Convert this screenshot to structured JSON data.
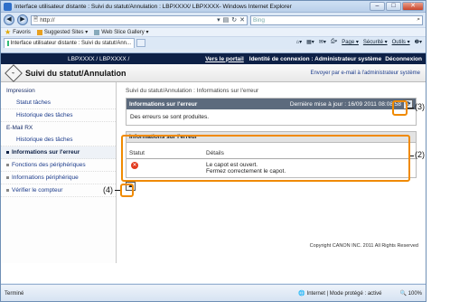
{
  "browser": {
    "title": "Interface utilisateur distante : Suivi du statut/Annulation : LBPXXXX/ LBPXXXX- Windows Internet Explorer",
    "url": "http://",
    "search_placeholder": "Bing",
    "favorites": {
      "label": "Favoris",
      "suggested": "Suggested Sites ▾",
      "gallery": "Web Slice Gallery ▾"
    },
    "tab_title": "Interface utilisateur distante : Suivi du statut/Ann...",
    "cmd": {
      "page": "Page ▾",
      "security": "Sécurité ▾",
      "tools": "Outils ▾",
      "help": "❷▾"
    },
    "status": {
      "done": "Terminé",
      "zone": "Internet | Mode protégé : activé",
      "zoom": "100%"
    }
  },
  "header": {
    "device": "LBPXXXX / LBPXXXX /",
    "portal": "Vers le portail",
    "login": "Identité de connexion : Administrateur système",
    "logout": "Déconnexion"
  },
  "page": {
    "title": "Suivi du statut/Annulation",
    "email_link": "Envoyer par e-mail à l'administrateur système"
  },
  "sidebar": {
    "group_print": "Impression",
    "items_print": [
      "Statut tâches",
      "Historique des tâches"
    ],
    "group_email": "E-Mail RX",
    "items_email": [
      "Historique des tâches"
    ],
    "items_main": [
      "Informations sur l'erreur",
      "Fonctions des périphériques",
      "Informations périphérique",
      "Vérifier le compteur"
    ]
  },
  "main": {
    "breadcrumb": "Suivi du statut/Annulation : Informations sur l'erreur",
    "panel_title": "Informations sur l'erreur",
    "last_update": "Dernière mise à jour : 16/09 2011 08:08:58",
    "panel_message": "Des erreurs se sont produites.",
    "info_title": "Informations sur l'erreur",
    "col_status": "Statut",
    "col_details": "Détails",
    "detail_line1": "Le capot est ouvert.",
    "detail_line2": "Fermez correctement le capot.",
    "copyright": "Copyright CANON INC. 2011 All Rights Reserved"
  },
  "callouts": {
    "c1": "(3)",
    "c2": "(2)",
    "c3": "(4)"
  },
  "colors": {
    "callout": "#f08a00",
    "header": "#0d2046",
    "error": "#e23a1e"
  }
}
